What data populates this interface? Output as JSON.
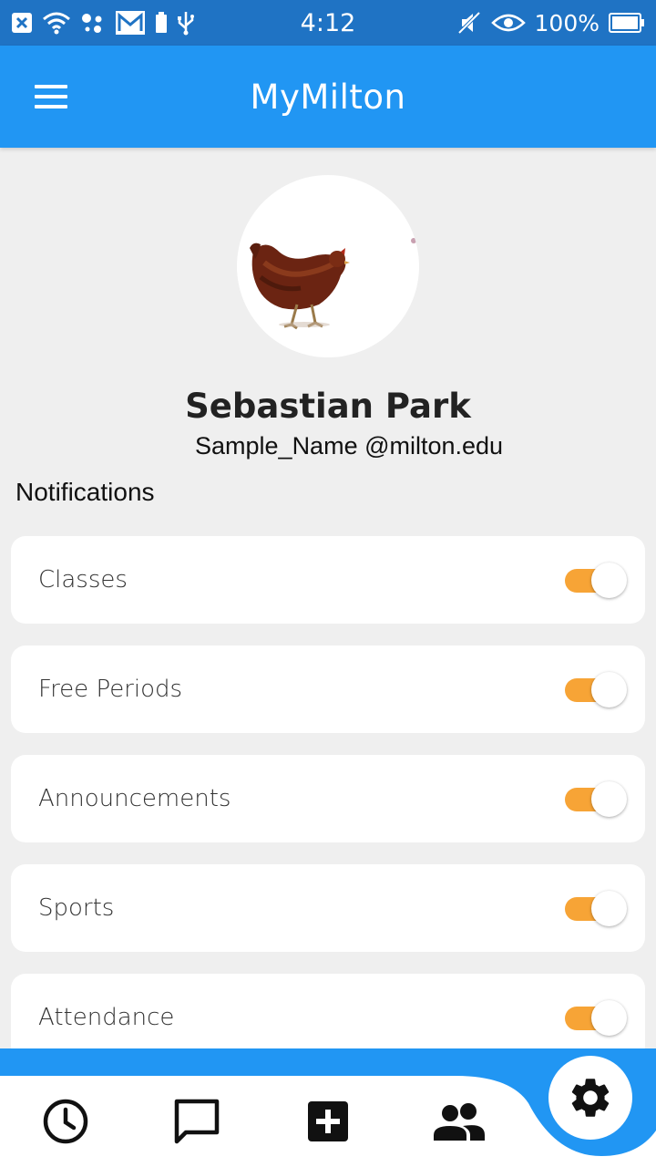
{
  "status_bar": {
    "time": "4:12",
    "battery_percent": "100%",
    "left_icons": [
      "close-box-icon",
      "wifi-icon",
      "assistant-dots-icon",
      "gmail-icon",
      "battery-small-icon",
      "usb-icon"
    ],
    "right_icons": [
      "mute-icon",
      "eye-icon",
      "battery-icon"
    ]
  },
  "app_bar": {
    "title": "MyMilton",
    "menu_icon": "hamburger-menu-icon"
  },
  "profile": {
    "name": "Sebastian Park",
    "email": "Sample_Name @milton.edu",
    "avatar": "hen-photo"
  },
  "notifications": {
    "title": "Notifications",
    "items": [
      {
        "label": "Classes",
        "enabled": true
      },
      {
        "label": "Free Periods",
        "enabled": true
      },
      {
        "label": "Announcements",
        "enabled": true
      },
      {
        "label": "Sports",
        "enabled": true
      },
      {
        "label": "Attendance",
        "enabled": true
      }
    ]
  },
  "bottom_nav": {
    "items": [
      "clock-icon",
      "chat-icon",
      "add-box-icon",
      "people-icon",
      "gear-icon"
    ],
    "active": "gear-icon"
  },
  "colors": {
    "status_bar": "#1f73c4",
    "app_bar": "#2196f3",
    "toggle_on": "#f7a436",
    "background": "#efefef"
  }
}
